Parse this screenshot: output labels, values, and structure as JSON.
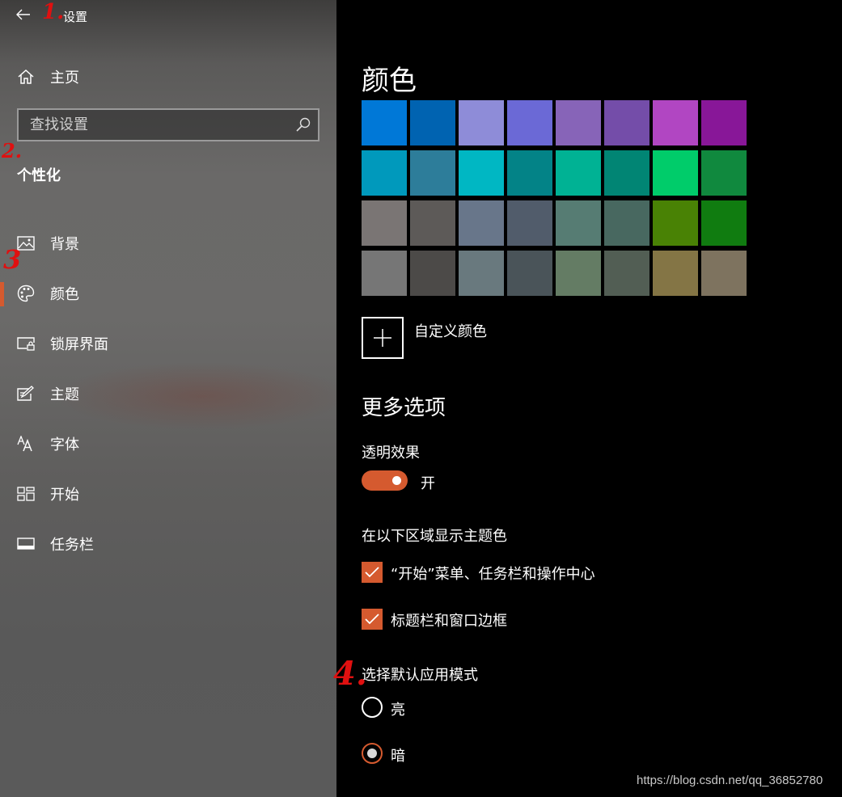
{
  "window": {
    "title": "设置"
  },
  "sidebar": {
    "home_label": "主页",
    "search_placeholder": "查找设置",
    "section_heading": "个性化",
    "items": [
      {
        "label": "背景",
        "icon": "picture-icon",
        "active": false
      },
      {
        "label": "颜色",
        "icon": "palette-icon",
        "active": true
      },
      {
        "label": "锁屏界面",
        "icon": "lock-screen-icon",
        "active": false
      },
      {
        "label": "主题",
        "icon": "theme-icon",
        "active": false
      },
      {
        "label": "字体",
        "icon": "font-icon",
        "active": false
      },
      {
        "label": "开始",
        "icon": "start-icon",
        "active": false
      },
      {
        "label": "任务栏",
        "icon": "taskbar-icon",
        "active": false
      }
    ]
  },
  "main": {
    "title": "颜色",
    "swatches": [
      "#0078d7",
      "#0063b1",
      "#8e8cd8",
      "#6b69d6",
      "#8764b8",
      "#744da9",
      "#b146c2",
      "#881798",
      "#0099bc",
      "#2d7d9a",
      "#00b7c3",
      "#038387",
      "#00b294",
      "#018574",
      "#00cc6a",
      "#10893e",
      "#7a7574",
      "#5d5a58",
      "#68768a",
      "#515c6b",
      "#567c73",
      "#486860",
      "#498205",
      "#107c10",
      "#767676",
      "#4c4a48",
      "#69797e",
      "#4a5459",
      "#647c64",
      "#525e54",
      "#847545",
      "#7e735f"
    ],
    "custom_color_label": "自定义颜色",
    "more_options_title": "更多选项",
    "transparency": {
      "label": "透明效果",
      "state_label": "开",
      "on": true
    },
    "accent_surfaces": {
      "label": "在以下区域显示主题色",
      "options": [
        {
          "label": "“开始”菜单、任务栏和操作中心",
          "checked": true
        },
        {
          "label": "标题栏和窗口边框",
          "checked": true
        }
      ]
    },
    "app_mode": {
      "label": "选择默认应用模式",
      "options": [
        {
          "label": "亮",
          "selected": false
        },
        {
          "label": "暗",
          "selected": true
        }
      ]
    }
  },
  "annotations": [
    "1.",
    "2.",
    "3",
    "4."
  ],
  "watermark": "https://blog.csdn.net/qq_36852780",
  "colors": {
    "accent": "#d55a2f",
    "annotation": "#e01010"
  }
}
